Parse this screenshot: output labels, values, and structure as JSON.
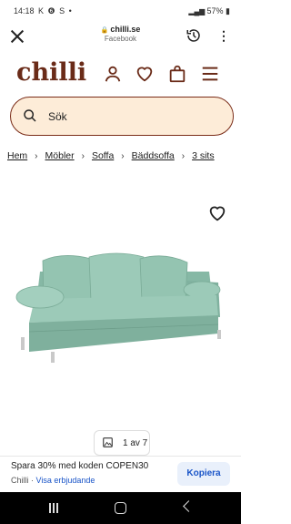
{
  "status_bar": {
    "time": "14:18",
    "notifications": "K ❻ S •",
    "battery": "57%"
  },
  "browser": {
    "url": "chilli.se",
    "subtitle": "Facebook"
  },
  "site": {
    "logo": "chilli"
  },
  "search": {
    "placeholder": "Sök"
  },
  "breadcrumb": [
    "Hem",
    "Möbler",
    "Soffa",
    "Bäddsoffa",
    "3 sits"
  ],
  "gallery": {
    "counter": "1 av 7"
  },
  "promo": {
    "title": "Spara 30% med koden COPEN30",
    "source": "Chilli",
    "separator": " · ",
    "link": "Visa erbjudande",
    "button": "Kopiera"
  },
  "colors": {
    "brand": "#6a2b18",
    "search_bg": "#fdecd8",
    "sofa": "#8dbfad",
    "link": "#1a55c8"
  }
}
